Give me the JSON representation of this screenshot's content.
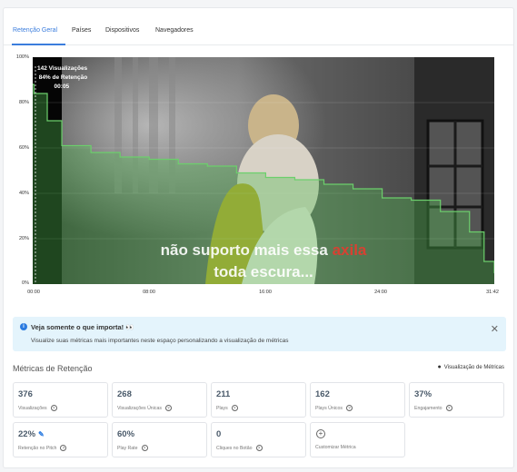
{
  "tabs": [
    {
      "label": "Retenção Geral"
    },
    {
      "label": "Países"
    },
    {
      "label": "Dispositivos"
    },
    {
      "label": "Navegadores"
    }
  ],
  "chart": {
    "y_ticks": [
      "100%",
      "80%",
      "60%",
      "40%",
      "20%",
      "0%"
    ],
    "x_ticks": [
      "00:00",
      "08:00",
      "16:00",
      "24:00",
      "31:42"
    ],
    "tooltip": {
      "views": "142 Visualizações",
      "retention": "84% de Retenção",
      "time": "00:05"
    },
    "subtitle_line1_a": "não suporto mais essa ",
    "subtitle_line1_b": "axila",
    "subtitle_line2": "toda escura...",
    "accent": "#3b7ddd",
    "line_color": "#6ccf6c"
  },
  "chart_data": {
    "type": "area",
    "xlabel": "",
    "ylabel": "",
    "ylim": [
      0,
      100
    ],
    "x": [
      "00:00",
      "00:05",
      "01:00",
      "02:00",
      "04:00",
      "06:00",
      "08:00",
      "10:00",
      "12:00",
      "14:00",
      "16:00",
      "18:00",
      "20:00",
      "22:00",
      "24:00",
      "26:00",
      "28:00",
      "30:00",
      "31:00",
      "31:42"
    ],
    "series": [
      {
        "values": [
          88,
          84,
          72,
          61,
          58,
          56,
          55,
          53,
          52,
          49,
          47,
          46,
          44,
          42,
          38,
          37,
          32,
          23,
          10,
          5
        ]
      }
    ]
  },
  "alert": {
    "title": "Veja somente o que importa!",
    "emoji": "👀",
    "text": "Visualize suas métricas mais importantes neste espaço personalizando a visualização de métricas"
  },
  "section": {
    "title": "Métricas de Retenção",
    "link": "Visualização de Métricas"
  },
  "metrics": [
    {
      "value": "376",
      "label": "Visualizações"
    },
    {
      "value": "268",
      "label": "Visualizações Únicas"
    },
    {
      "value": "211",
      "label": "Plays"
    },
    {
      "value": "162",
      "label": "Plays Únicos"
    },
    {
      "value": "37%",
      "label": "Engajamento"
    },
    {
      "value": "22%",
      "label": "Retenção no Pitch"
    },
    {
      "value": "60%",
      "label": "Play Rate"
    },
    {
      "value": "0",
      "label": "Cliques no Botão"
    }
  ],
  "customize": {
    "label": "Customizar Métrica"
  }
}
